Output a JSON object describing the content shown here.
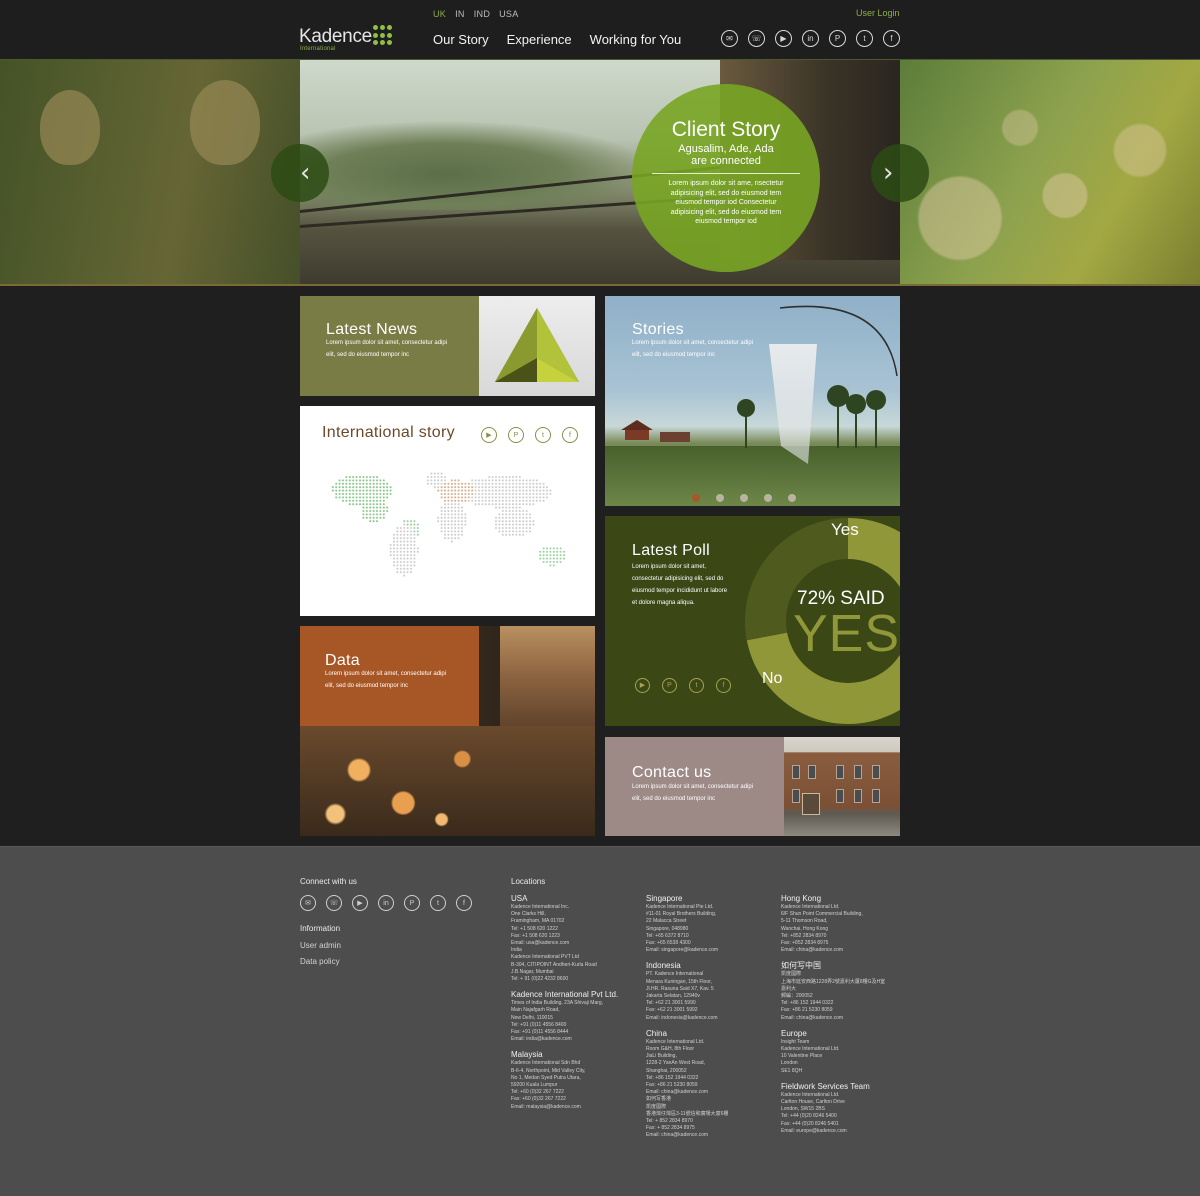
{
  "brand": {
    "name": "Kadence",
    "sub": "International"
  },
  "regions": [
    "UK",
    "IN",
    "IND",
    "USA"
  ],
  "user_login": "User Login",
  "nav": [
    "Our Story",
    "Experience",
    "Working for You"
  ],
  "social_icons": [
    "email-icon",
    "phone-icon",
    "youtube-icon",
    "linkedin-icon",
    "pinterest-icon",
    "twitter-icon",
    "facebook-icon"
  ],
  "hero": {
    "title": "Client Story",
    "subtitle_1": "Agusalim, Ade, Ada",
    "subtitle_2": "are connected",
    "body": "Lorem ipsum dolor sit ame, nsectetur adipisicing elit, sed do eiusmod tem eiusmod tempor iod Consectetur adipisicing elit, sed do eiusmod tem eiusmod tempor iod"
  },
  "tiles": {
    "news": {
      "title": "Latest News",
      "text_1": "Lorem ipsum dolor sit amet, consectetur adipi",
      "text_2": "elit, sed do eiusmod tempor inc"
    },
    "intl": {
      "title": "International story"
    },
    "data": {
      "title": "Data",
      "text_1": "Lorem ipsum dolor sit amet, consectetur adipi",
      "text_2": "elit, sed do eiusmod tempor inc"
    },
    "stories": {
      "title": "Stories",
      "text_1": "Lorem ipsum dolor sit amet, consectetur adipi",
      "text_2": "elit, sed do eiusmod tempor inc"
    },
    "poll": {
      "title": "Latest Poll",
      "text_1": "Lorem ipsum dolor sit amet,",
      "text_2": "consectetur adipisicing elit, sed do",
      "text_3": "eiusmod tempor incididunt ut labore",
      "text_4": "et dolore magna aliqua.",
      "yes_label": "Yes",
      "no_label": "No",
      "result_line": "72% SAID",
      "result_big": "YES",
      "yes_fraction": 0.72
    },
    "contact": {
      "title": "Contact us",
      "text_1": "Lorem ipsum dolor sit amet, consectetur adipi",
      "text_2": "elit, sed do eiusmod tempor inc"
    }
  },
  "colors": {
    "accent": "#8bb04a",
    "news": "#7a7c45",
    "data": "#a75725",
    "poll": "#3c4716",
    "contact": "#9d8986"
  },
  "footer": {
    "connect": "Connect with us",
    "information": "Information",
    "user_admin": "User admin",
    "data_policy": "Data policy",
    "locations": "Locations",
    "col1": [
      {
        "name": "USA",
        "lines": [
          "Kadence International Inc.",
          "One Clarks Hill,",
          "Framingham, MA 01702",
          "Tel: +1 508 620 1222",
          "Fax: +1 508 620 1223",
          "Email: usa@kadence.com",
          "India",
          "Kadence International PVT Ltd",
          "B-304, CITIPOINT Andheri-Kurla Road",
          "J.B.Nagar, Mumbai",
          "Tel: + 91 (0)22 4232 8600"
        ]
      },
      {
        "name": "Kadence International Pvt Ltd.",
        "lines": [
          "Times of India Building, 23A Shivaji Marg,",
          "Main Najafgarh Road,",
          "New Delhi, 110015",
          "Tel: +91 (0)11 4556 8400",
          "Fax: +91 (0)11 4556 8444",
          "Email: india@kadence.com"
        ]
      },
      {
        "name": "Malaysia",
        "lines": [
          "Kadence International Sdn Bhd",
          "B-6-4, Northpoint, Mid Valley City,",
          "No 1, Medan Syed Putra Utara,",
          "59200 Kuala Lumpur",
          "Tel: +60 (0)32 267 7222",
          "Fax: +60 (0)32 267 7222",
          "Email: malaysia@kadence.com"
        ]
      }
    ],
    "col2": [
      {
        "name": "Singapore",
        "lines": [
          "Kadence International Pte Ltd.",
          "#11-01 Royal Brothers Building,",
          "22 Malacca Street",
          "Singapore, 048980",
          "Tel: +65 6372 8710",
          "Fax: +65 6538 4300",
          "Email: singapore@kadence.com"
        ]
      },
      {
        "name": "Indonesia",
        "lines": [
          "PT. Kadence International",
          "Menara Kuningan, 15th Floor,",
          "Jl.HR. Rasuna Said X7, Kav. 5",
          "Jakarta Selatan, 12940v",
          "Tel: +62 21 3001 5990",
          "Fax: +62 21 3001 5992",
          "Email: indonesia@kadence.com"
        ]
      },
      {
        "name": "China",
        "lines": [
          "Kadence International Ltd.",
          "Room G&H, 8th Floor",
          "JiaLi Building,",
          "1228-2 YanAn West Road,",
          "Shanghai, 200052",
          "Tel: +86 152 1944 0322",
          "Fax: +86 21 5230 8059",
          "Email: china@kadence.com",
          "如何写香港",
          "凯度國際",
          "香港灣仔灣區3-11號信和廣場大廈6樓",
          "Tel: + 852 2834 8970",
          "Fax: + 852 2834 8975",
          "Email: china@kadence.com"
        ]
      }
    ],
    "col3": [
      {
        "name": "Hong Kong",
        "lines": [
          "Kadence International Ltd.",
          "6/F Shun Point Commercial Building,",
          "5-11 Thomson Road,",
          "Wanchai, Hong Kong",
          "Tel: +852 2834 8970",
          "Fax: +852 2834 8975",
          "Email: china@kadence.com"
        ]
      },
      {
        "name": "如何写中国",
        "lines": [
          "凯度國際",
          "上海市延安西路1228弄2號嘉利大厦8樓G及H室",
          "嘉利大",
          "郵編：200052",
          "Tel: +86 152 1944 0322",
          "Fax: +86 21 5230 8059",
          "Email: china@kadence.com"
        ]
      },
      {
        "name": "Europe",
        "lines": [
          "Insight Team",
          "Kadence International Ltd.",
          "10 Valentine Place",
          "London",
          "SE1 8QH"
        ]
      },
      {
        "name": "Fieldwork Services Team",
        "lines": [
          "Kadence International Ltd.",
          "Carlton House, Carlton Drive",
          "London, SW15 2BS",
          "Tel: +44 (0)20 8246 5400",
          "Fax: +44 (0)20 8246 5401",
          "Email: europe@kadence.com"
        ]
      }
    ]
  }
}
